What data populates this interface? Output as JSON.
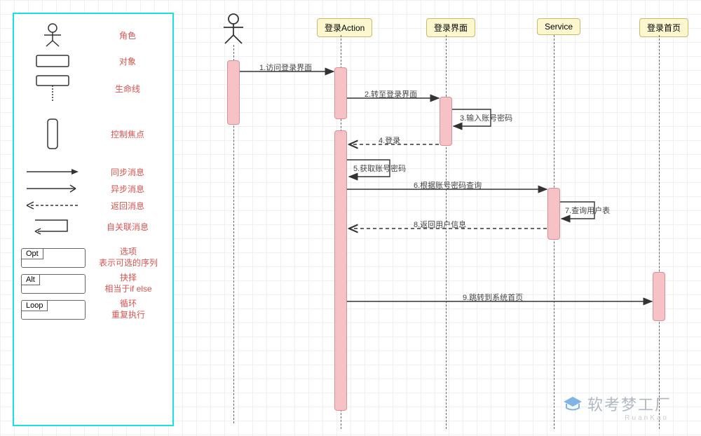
{
  "legend": {
    "actor": "角色",
    "object": "对象",
    "lifeline": "生命线",
    "focus": "控制焦点",
    "sync": "同步消息",
    "async": "异步消息",
    "return": "返回消息",
    "self": "自关联消息",
    "opt_tag": "Opt",
    "opt": "选项\n表示可选的序列",
    "alt_tag": "Alt",
    "alt": "抉择\n相当于if else",
    "loop_tag": "Loop",
    "loop": "循环\n重复执行"
  },
  "participants": {
    "action": "登录Action",
    "ui": "登录界面",
    "service": "Service",
    "home": "登录首页"
  },
  "messages": {
    "m1": "1.访问登录界面",
    "m2": "2.转至登录界面",
    "m3": "3.输入账号密码",
    "m4": "4.登录",
    "m5": "5.获取账号密码",
    "m6": "6.根据账号密码查询",
    "m7": "7.查询用户表",
    "m8": "8.返回用户信息",
    "m9": "9.跳转到系统首页"
  },
  "watermark": {
    "main": "软考梦工厂",
    "sub": "RuanKao"
  }
}
